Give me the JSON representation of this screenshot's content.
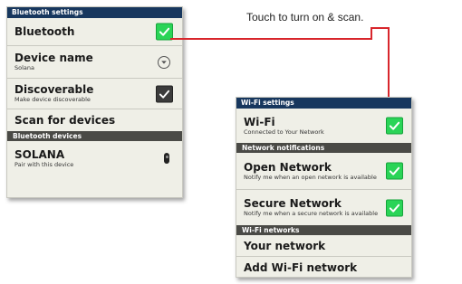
{
  "bluetooth": {
    "header": "Bluetooth settings",
    "bluetooth_label": "Bluetooth",
    "device_name_label": "Device name",
    "device_name_value": "Solana",
    "discoverable_label": "Discoverable",
    "discoverable_sub": "Make device discoverable",
    "scan_label": "Scan for devices",
    "devices_header": "Bluetooth devices",
    "device": {
      "name": "SOLANA",
      "sub": "Pair with this device"
    }
  },
  "callout": {
    "text": "Touch to turn on & scan."
  },
  "wifi": {
    "header": "Wi-Fi settings",
    "wifi_label": "Wi-Fi",
    "wifi_sub": "Connected to Your Network",
    "notif_header": "Network notifications",
    "open_label": "Open Network",
    "open_sub": "Notify me when an open network is available",
    "secure_label": "Secure Network",
    "secure_sub": "Notify me when a secure network is available",
    "networks_header": "Wi-Fi networks",
    "your_network": "Your network",
    "add_network": "Add Wi-Fi network"
  },
  "colors": {
    "header_bg": "#17375e",
    "section_bg": "#4a4a46",
    "checkbox_on": "#2ad457",
    "callout_line": "#d8262c"
  },
  "icons": {
    "check": "check-icon",
    "dropdown": "chevron-down-icon",
    "device": "phone-icon"
  }
}
